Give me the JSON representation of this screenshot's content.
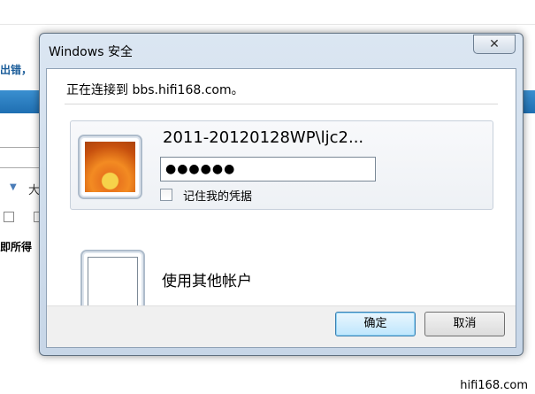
{
  "background": {
    "banner_text": "出错，",
    "big_char": "大",
    "note_text": "即所得"
  },
  "dialog": {
    "title": "Windows 安全",
    "close_glyph": "✕",
    "connecting_text": "正在连接到 bbs.hifi168.com。",
    "credential": {
      "username": "2011-20120128WP\\ljc2...",
      "password_masked": "●●●●●●",
      "remember_label": "记住我的凭据",
      "remember_checked": false
    },
    "other_account_label": "使用其他帐户",
    "buttons": {
      "ok": "确定",
      "cancel": "取消"
    }
  },
  "watermark": "hifi168.com",
  "colors": {
    "accent_blue": "#1f6fb2",
    "frame": "#c7d6e7"
  }
}
